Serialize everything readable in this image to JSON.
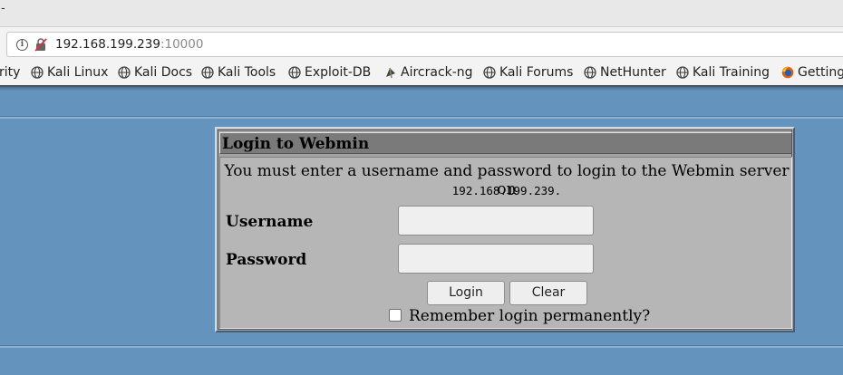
{
  "browser": {
    "top_fragment": "-",
    "url_host": "192.168.199.239",
    "url_port": ":10000"
  },
  "bookmarks": [
    {
      "label": "rity",
      "icon": "none"
    },
    {
      "label": "Kali Linux",
      "icon": "globe-icon"
    },
    {
      "label": "Kali Docs",
      "icon": "globe-icon"
    },
    {
      "label": "Kali Tools",
      "icon": "globe-icon"
    },
    {
      "label": "Exploit-DB",
      "icon": "globe-icon"
    },
    {
      "label": "Aircrack-ng",
      "icon": "aircrack-icon"
    },
    {
      "label": "Kali Forums",
      "icon": "globe-icon"
    },
    {
      "label": "NetHunter",
      "icon": "globe-icon"
    },
    {
      "label": "Kali Training",
      "icon": "globe-icon"
    },
    {
      "label": "Getting",
      "icon": "firefox-icon"
    }
  ],
  "login": {
    "title": "Login to Webmin",
    "message": "You must enter a username and password to login to the Webmin server on",
    "host": "192.168.199.239.",
    "username_label": "Username",
    "username_value": "",
    "password_label": "Password",
    "password_value": "",
    "login_button": "Login",
    "clear_button": "Clear",
    "remember_label": "Remember login permanently?",
    "remember_checked": false
  },
  "colors": {
    "page_background": "#6493bd",
    "panel_background": "#b6b6b6",
    "title_background": "#7a7a7a"
  }
}
